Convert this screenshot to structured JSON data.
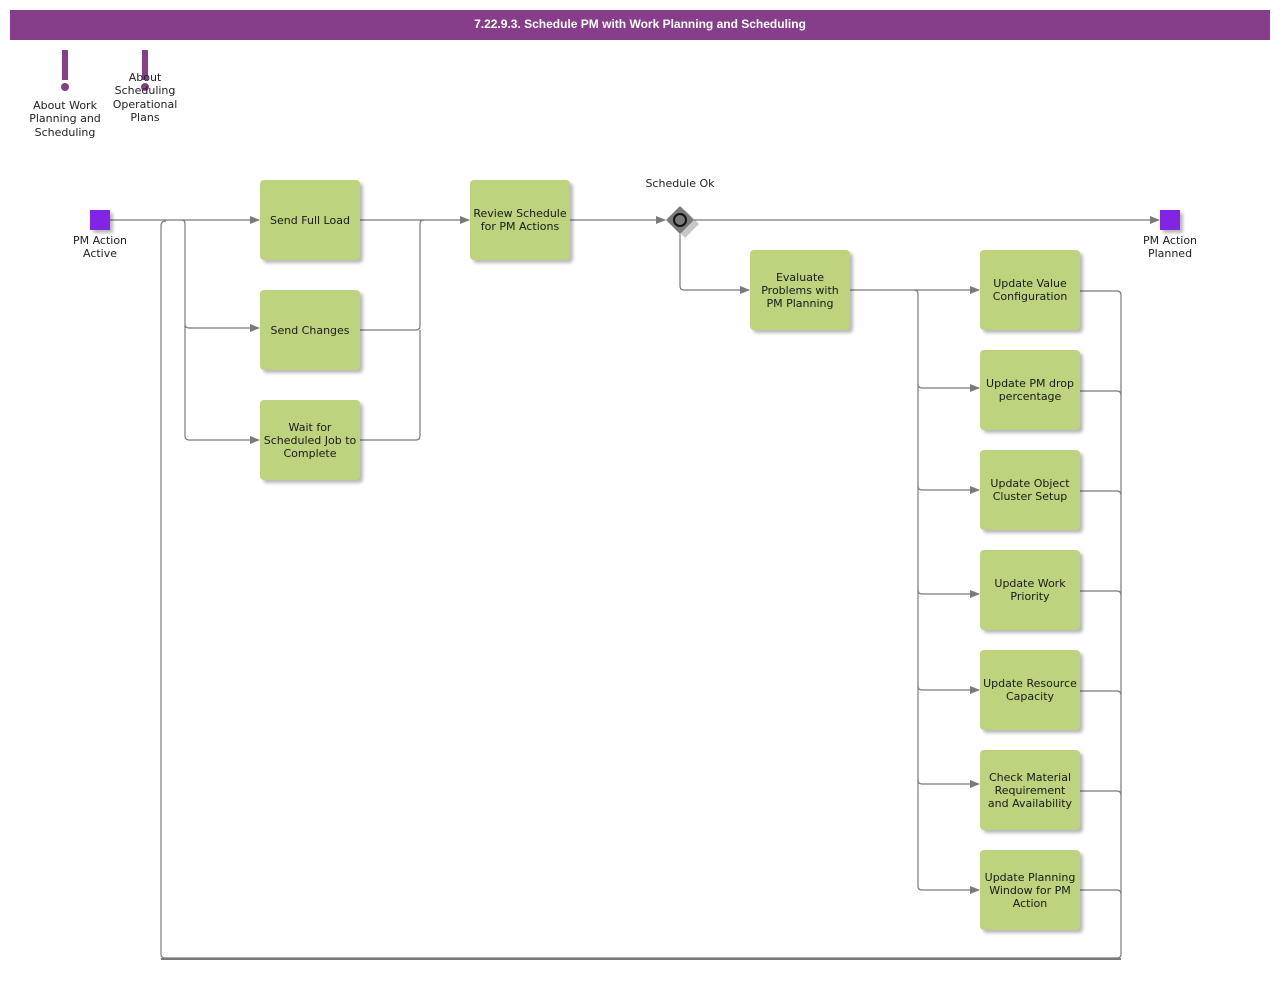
{
  "header": {
    "title": "7.22.9.3. Schedule PM with Work Planning and Scheduling"
  },
  "colors": {
    "title_bar": "#873e8a",
    "task_fill": "#bdd37d",
    "event_fill": "#8224e3",
    "gateway_fill": "#7a7a7a",
    "connector": "#7a7a7a"
  },
  "notes": [
    {
      "icon": "exclamation-icon",
      "label": "About Work Planning and Scheduling"
    },
    {
      "icon": "exclamation-icon",
      "label": "About Scheduling Operational Plans"
    }
  ],
  "events": {
    "start": {
      "label": "PM Action Active"
    },
    "end": {
      "label": "PM Action Planned"
    }
  },
  "gateway": {
    "label": "Schedule Ok"
  },
  "tasks": {
    "send_full_load": "Send Full Load",
    "send_changes": "Send Changes",
    "wait_for_job": "Wait for Scheduled Job to Complete",
    "review_schedule": "Review Schedule for PM Actions",
    "evaluate_problems": "Evaluate Problems with PM Planning",
    "update_value_config": "Update Value Configuration",
    "update_pm_drop": "Update PM drop percentage",
    "update_object_cluster": "Update Object Cluster Setup",
    "update_work_priority": "Update Work Priority",
    "update_resource_capacity": "Update Resource Capacity",
    "check_material": "Check Material Requirement and Availability",
    "update_planning_window": "Update Planning Window for PM Action"
  }
}
